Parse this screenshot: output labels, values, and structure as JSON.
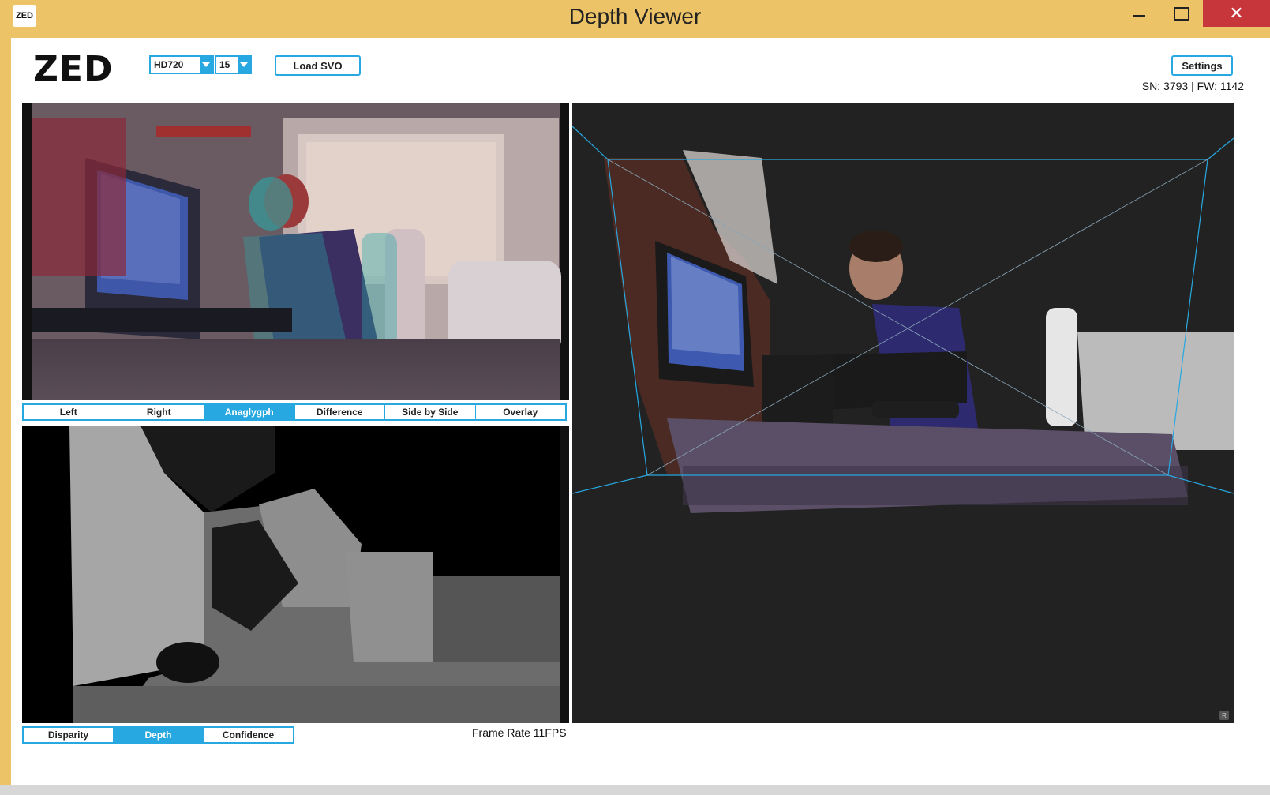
{
  "window": {
    "icon_label": "ZED",
    "title": "Depth Viewer",
    "minimize": "minimize",
    "maximize": "maximize",
    "close_label": "✕"
  },
  "toolbar": {
    "logo": "ZED",
    "resolution": "HD720",
    "fps": "15",
    "load_svo": "Load SVO",
    "settings": "Settings",
    "serial": "SN: 3793 | FW: 1142"
  },
  "image_view": {
    "tabs": [
      "Left",
      "Right",
      "Anaglygph",
      "Difference",
      "Side by Side",
      "Overlay"
    ],
    "active_tab": "Anaglygph"
  },
  "depth_view": {
    "tabs": [
      "Disparity",
      "Depth",
      "Confidence"
    ],
    "active_tab": "Depth"
  },
  "status": {
    "frame_rate": "Frame Rate 11FPS"
  },
  "point_cloud": {
    "badge": "R"
  },
  "colors": {
    "accent": "#28a8e0",
    "titlebar": "#ecc366",
    "close": "#c7363a",
    "viewer_bg": "#222222"
  }
}
